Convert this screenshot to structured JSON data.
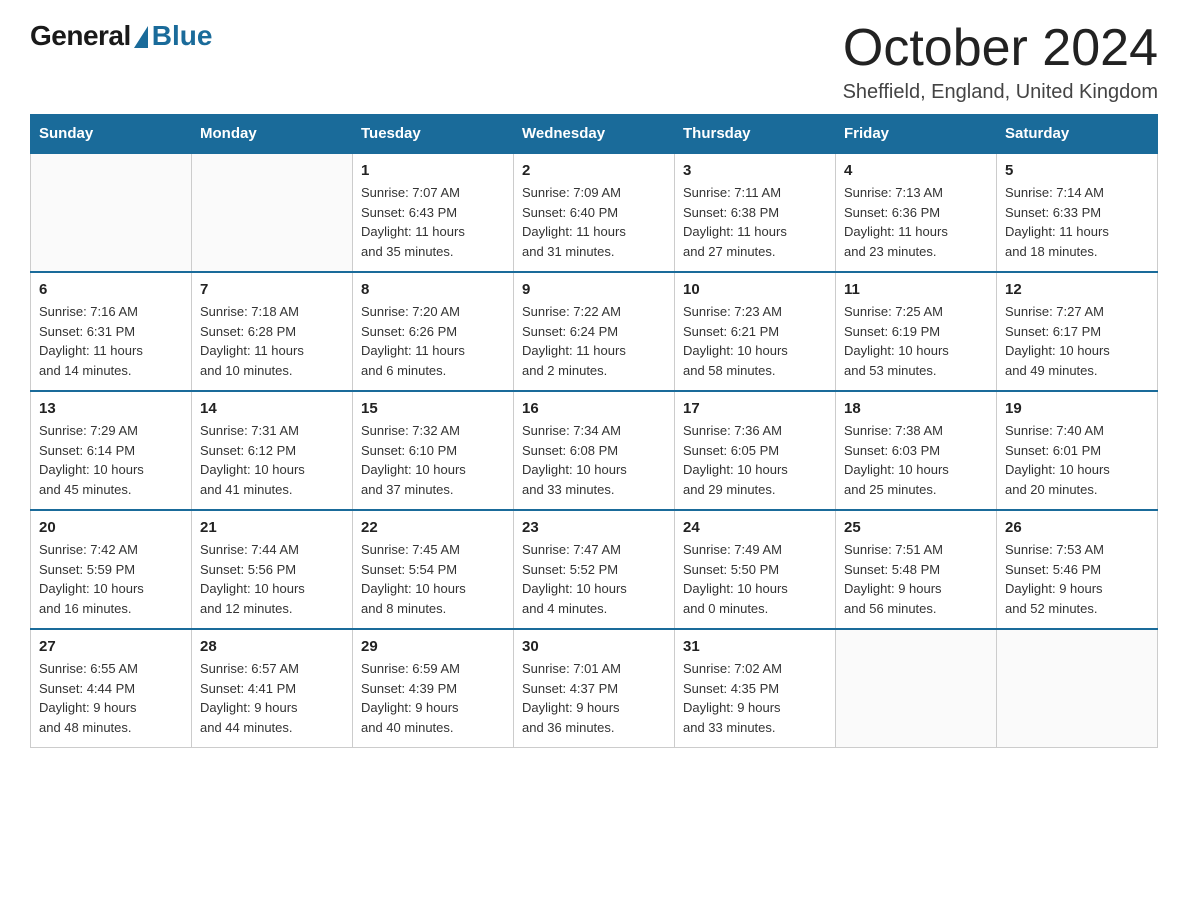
{
  "logo": {
    "general": "General",
    "blue": "Blue"
  },
  "title": "October 2024",
  "location": "Sheffield, England, United Kingdom",
  "weekdays": [
    "Sunday",
    "Monday",
    "Tuesday",
    "Wednesday",
    "Thursday",
    "Friday",
    "Saturday"
  ],
  "weeks": [
    [
      {
        "day": "",
        "info": ""
      },
      {
        "day": "",
        "info": ""
      },
      {
        "day": "1",
        "info": "Sunrise: 7:07 AM\nSunset: 6:43 PM\nDaylight: 11 hours\nand 35 minutes."
      },
      {
        "day": "2",
        "info": "Sunrise: 7:09 AM\nSunset: 6:40 PM\nDaylight: 11 hours\nand 31 minutes."
      },
      {
        "day": "3",
        "info": "Sunrise: 7:11 AM\nSunset: 6:38 PM\nDaylight: 11 hours\nand 27 minutes."
      },
      {
        "day": "4",
        "info": "Sunrise: 7:13 AM\nSunset: 6:36 PM\nDaylight: 11 hours\nand 23 minutes."
      },
      {
        "day": "5",
        "info": "Sunrise: 7:14 AM\nSunset: 6:33 PM\nDaylight: 11 hours\nand 18 minutes."
      }
    ],
    [
      {
        "day": "6",
        "info": "Sunrise: 7:16 AM\nSunset: 6:31 PM\nDaylight: 11 hours\nand 14 minutes."
      },
      {
        "day": "7",
        "info": "Sunrise: 7:18 AM\nSunset: 6:28 PM\nDaylight: 11 hours\nand 10 minutes."
      },
      {
        "day": "8",
        "info": "Sunrise: 7:20 AM\nSunset: 6:26 PM\nDaylight: 11 hours\nand 6 minutes."
      },
      {
        "day": "9",
        "info": "Sunrise: 7:22 AM\nSunset: 6:24 PM\nDaylight: 11 hours\nand 2 minutes."
      },
      {
        "day": "10",
        "info": "Sunrise: 7:23 AM\nSunset: 6:21 PM\nDaylight: 10 hours\nand 58 minutes."
      },
      {
        "day": "11",
        "info": "Sunrise: 7:25 AM\nSunset: 6:19 PM\nDaylight: 10 hours\nand 53 minutes."
      },
      {
        "day": "12",
        "info": "Sunrise: 7:27 AM\nSunset: 6:17 PM\nDaylight: 10 hours\nand 49 minutes."
      }
    ],
    [
      {
        "day": "13",
        "info": "Sunrise: 7:29 AM\nSunset: 6:14 PM\nDaylight: 10 hours\nand 45 minutes."
      },
      {
        "day": "14",
        "info": "Sunrise: 7:31 AM\nSunset: 6:12 PM\nDaylight: 10 hours\nand 41 minutes."
      },
      {
        "day": "15",
        "info": "Sunrise: 7:32 AM\nSunset: 6:10 PM\nDaylight: 10 hours\nand 37 minutes."
      },
      {
        "day": "16",
        "info": "Sunrise: 7:34 AM\nSunset: 6:08 PM\nDaylight: 10 hours\nand 33 minutes."
      },
      {
        "day": "17",
        "info": "Sunrise: 7:36 AM\nSunset: 6:05 PM\nDaylight: 10 hours\nand 29 minutes."
      },
      {
        "day": "18",
        "info": "Sunrise: 7:38 AM\nSunset: 6:03 PM\nDaylight: 10 hours\nand 25 minutes."
      },
      {
        "day": "19",
        "info": "Sunrise: 7:40 AM\nSunset: 6:01 PM\nDaylight: 10 hours\nand 20 minutes."
      }
    ],
    [
      {
        "day": "20",
        "info": "Sunrise: 7:42 AM\nSunset: 5:59 PM\nDaylight: 10 hours\nand 16 minutes."
      },
      {
        "day": "21",
        "info": "Sunrise: 7:44 AM\nSunset: 5:56 PM\nDaylight: 10 hours\nand 12 minutes."
      },
      {
        "day": "22",
        "info": "Sunrise: 7:45 AM\nSunset: 5:54 PM\nDaylight: 10 hours\nand 8 minutes."
      },
      {
        "day": "23",
        "info": "Sunrise: 7:47 AM\nSunset: 5:52 PM\nDaylight: 10 hours\nand 4 minutes."
      },
      {
        "day": "24",
        "info": "Sunrise: 7:49 AM\nSunset: 5:50 PM\nDaylight: 10 hours\nand 0 minutes."
      },
      {
        "day": "25",
        "info": "Sunrise: 7:51 AM\nSunset: 5:48 PM\nDaylight: 9 hours\nand 56 minutes."
      },
      {
        "day": "26",
        "info": "Sunrise: 7:53 AM\nSunset: 5:46 PM\nDaylight: 9 hours\nand 52 minutes."
      }
    ],
    [
      {
        "day": "27",
        "info": "Sunrise: 6:55 AM\nSunset: 4:44 PM\nDaylight: 9 hours\nand 48 minutes."
      },
      {
        "day": "28",
        "info": "Sunrise: 6:57 AM\nSunset: 4:41 PM\nDaylight: 9 hours\nand 44 minutes."
      },
      {
        "day": "29",
        "info": "Sunrise: 6:59 AM\nSunset: 4:39 PM\nDaylight: 9 hours\nand 40 minutes."
      },
      {
        "day": "30",
        "info": "Sunrise: 7:01 AM\nSunset: 4:37 PM\nDaylight: 9 hours\nand 36 minutes."
      },
      {
        "day": "31",
        "info": "Sunrise: 7:02 AM\nSunset: 4:35 PM\nDaylight: 9 hours\nand 33 minutes."
      },
      {
        "day": "",
        "info": ""
      },
      {
        "day": "",
        "info": ""
      }
    ]
  ]
}
